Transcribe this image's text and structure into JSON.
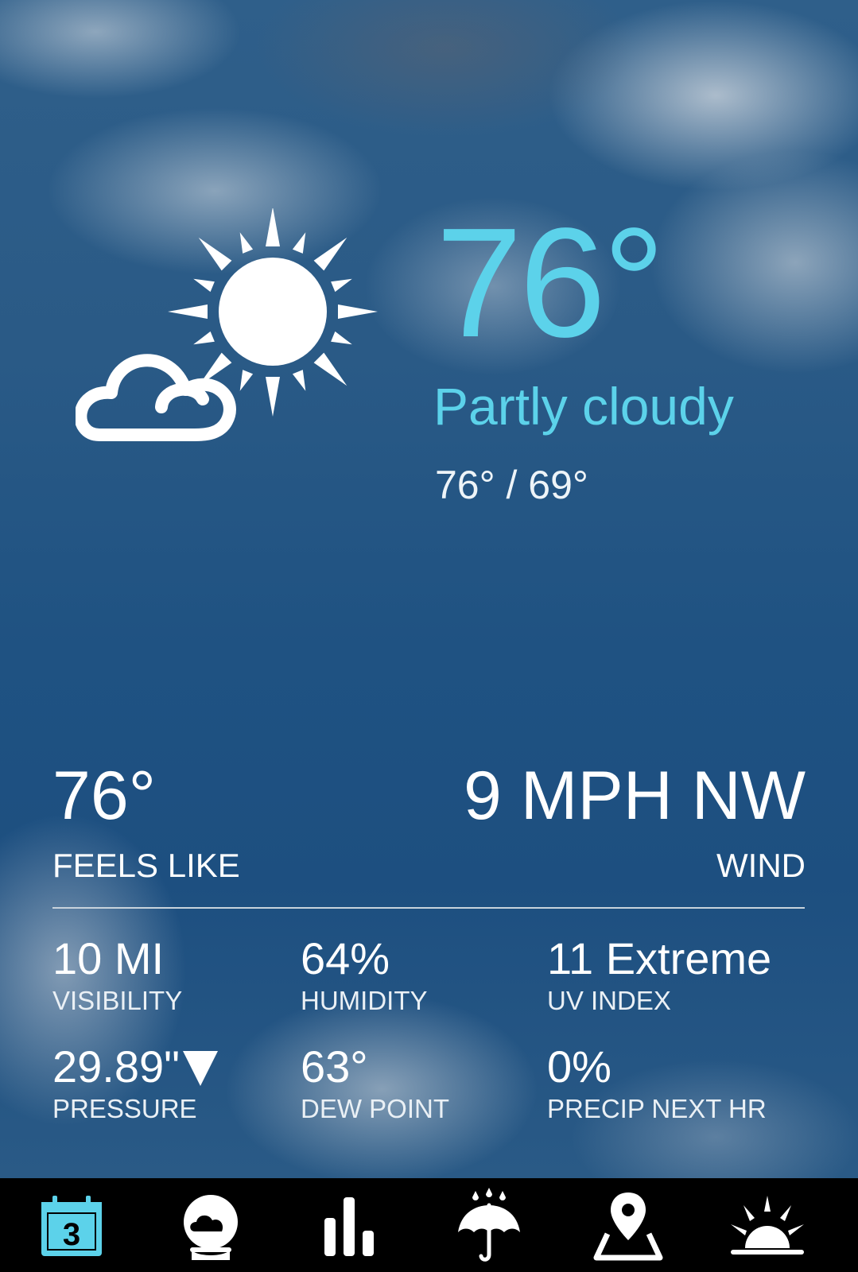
{
  "current": {
    "temperature": "76°",
    "condition": "Partly cloudy",
    "high_low": "76° / 69°",
    "icon": "partly-cloudy-sun-icon"
  },
  "feels_like": {
    "value": "76°",
    "label": "FEELS LIKE"
  },
  "wind": {
    "value": "9 MPH NW",
    "label": "WIND"
  },
  "details": {
    "visibility": {
      "value": "10 MI",
      "label": "VISIBILITY"
    },
    "humidity": {
      "value": "64%",
      "label": "HUMIDITY"
    },
    "uv_index": {
      "value": "11 Extreme",
      "label": "UV INDEX"
    },
    "pressure": {
      "value": "29.89\"",
      "trend_icon": "falling-triangle-icon",
      "label": "PRESSURE"
    },
    "dew_point": {
      "value": "63°",
      "label": "DEW POINT"
    },
    "precip": {
      "value": "0%",
      "label": "PRECIP NEXT HR"
    }
  },
  "nav": {
    "items": [
      {
        "icon": "calendar-icon",
        "badge": "3",
        "active": true
      },
      {
        "icon": "cloud-globe-icon"
      },
      {
        "icon": "bar-chart-icon"
      },
      {
        "icon": "umbrella-rain-icon"
      },
      {
        "icon": "map-pin-icon"
      },
      {
        "icon": "sunrise-icon"
      }
    ]
  },
  "colors": {
    "accent": "#5cd2ea",
    "nav_bg": "#000000",
    "active_icon": "#5cd2ea"
  }
}
